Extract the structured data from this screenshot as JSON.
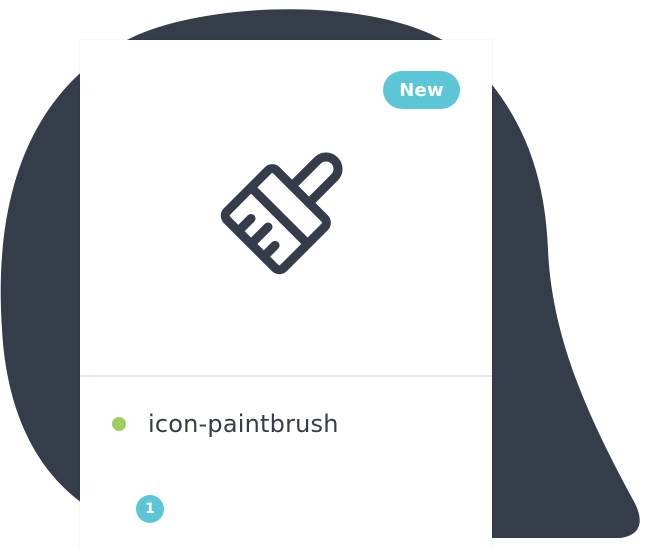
{
  "colors": {
    "backdrop": "#353c4a",
    "badge_bg": "#5cc6d6",
    "status_dot": "#9fcd63",
    "icon_stroke": "#353c4a",
    "count_bg": "#5cc6d6"
  },
  "card": {
    "badge_label": "New",
    "icon": "paintbrush-icon",
    "name": "icon-paintbrush",
    "count": "1"
  }
}
